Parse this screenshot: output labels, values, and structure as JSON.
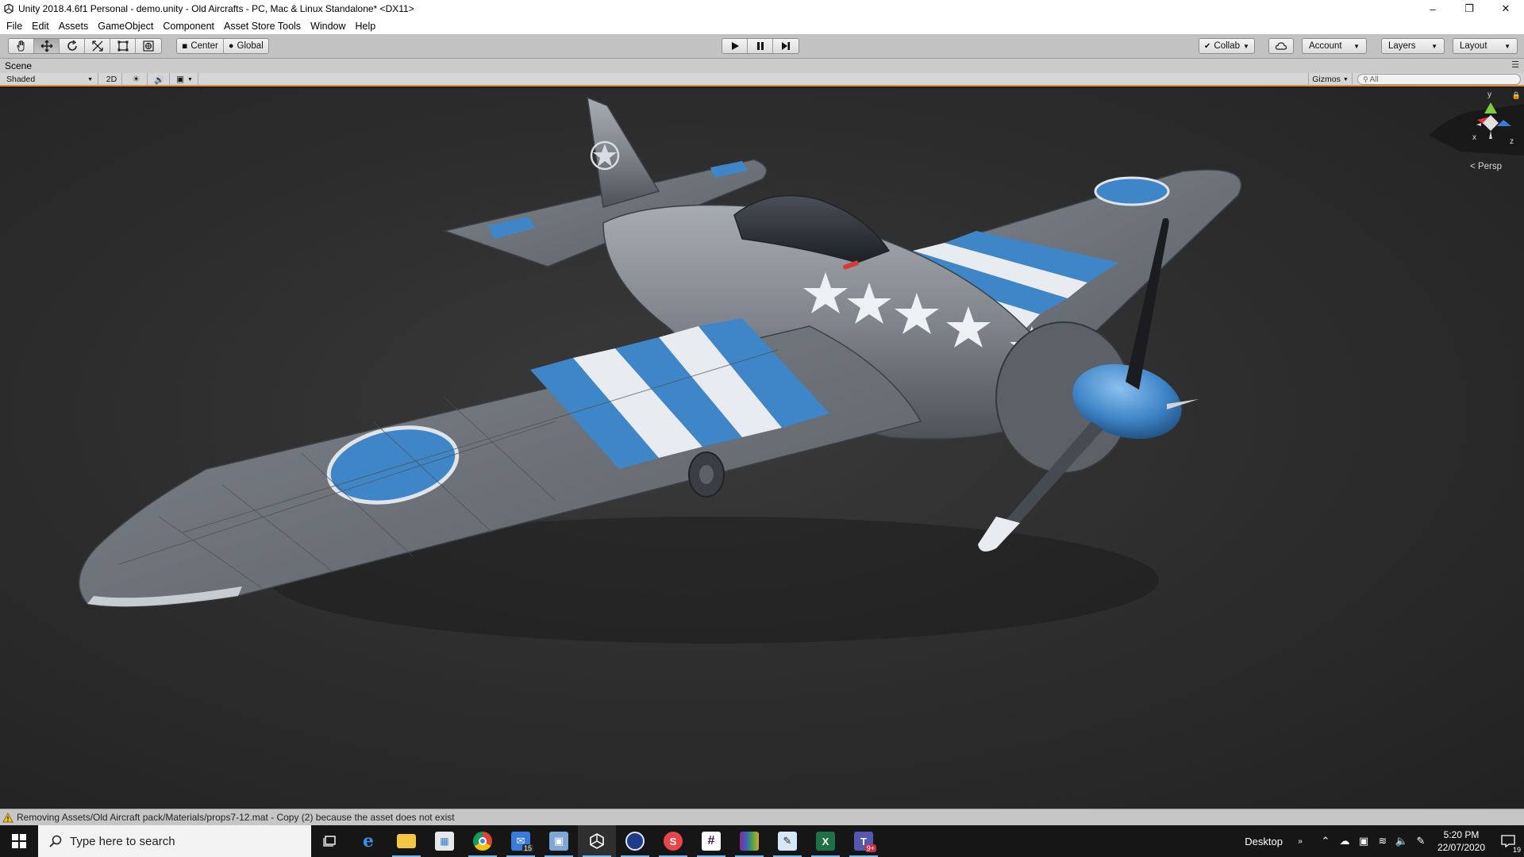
{
  "window": {
    "title": "Unity 2018.4.6f1 Personal - demo.unity - Old Aircrafts - PC, Mac & Linux Standalone* <DX11>",
    "controls": [
      "minimize-icon",
      "restore-icon",
      "close-icon"
    ]
  },
  "menu": [
    "File",
    "Edit",
    "Assets",
    "GameObject",
    "Component",
    "Asset Store Tools",
    "Window",
    "Help"
  ],
  "toolbar": {
    "tools": [
      "hand-tool-icon",
      "move-tool-icon",
      "rotate-tool-icon",
      "scale-tool-icon",
      "rect-tool-icon",
      "transform-tool-icon"
    ],
    "active_tool": "move-tool-icon",
    "pivot_label": "Center",
    "space_label": "Global",
    "collab_label": "Collab",
    "account_label": "Account",
    "layers_label": "Layers",
    "layout_label": "Layout"
  },
  "scene": {
    "tab_label": "Scene",
    "shading_mode": "Shaded",
    "mode_2d_label": "2D",
    "gizmos_label": "Gizmos",
    "search_placeholder": "All",
    "projection_label": "< Persp",
    "gizmo_axes": [
      "y",
      "x",
      "z"
    ]
  },
  "status": {
    "message": "Removing Assets/Old Aircraft pack/Materials/props7-12.mat - Copy (2) because the asset does not exist"
  },
  "taskbar": {
    "search_placeholder": "Type here to search",
    "desktop_label": "Desktop",
    "time": "5:20 PM",
    "date": "22/07/2020",
    "mail_badge": "15",
    "teams_badge": "9+",
    "notifications_count": "19",
    "apps": [
      "task-view-icon",
      "edge-icon",
      "file-explorer-icon",
      "store-icon",
      "chrome-icon",
      "mail-icon",
      "remote-desktop-icon",
      "unity-icon",
      "cinema4d-icon",
      "substance-icon",
      "slack-icon",
      "winrar-icon",
      "paint-icon",
      "excel-icon",
      "teams-icon"
    ]
  },
  "colors": {
    "scene_bg": "#2e2e2e",
    "toolbar_bg": "#c2c2c2",
    "accent_orange": "#e88a3a",
    "plane_body": "#8a8f96",
    "plane_blue": "#3f86c8",
    "plane_stripe_white": "#e8ecf0",
    "taskbar_bg": "#161616"
  }
}
